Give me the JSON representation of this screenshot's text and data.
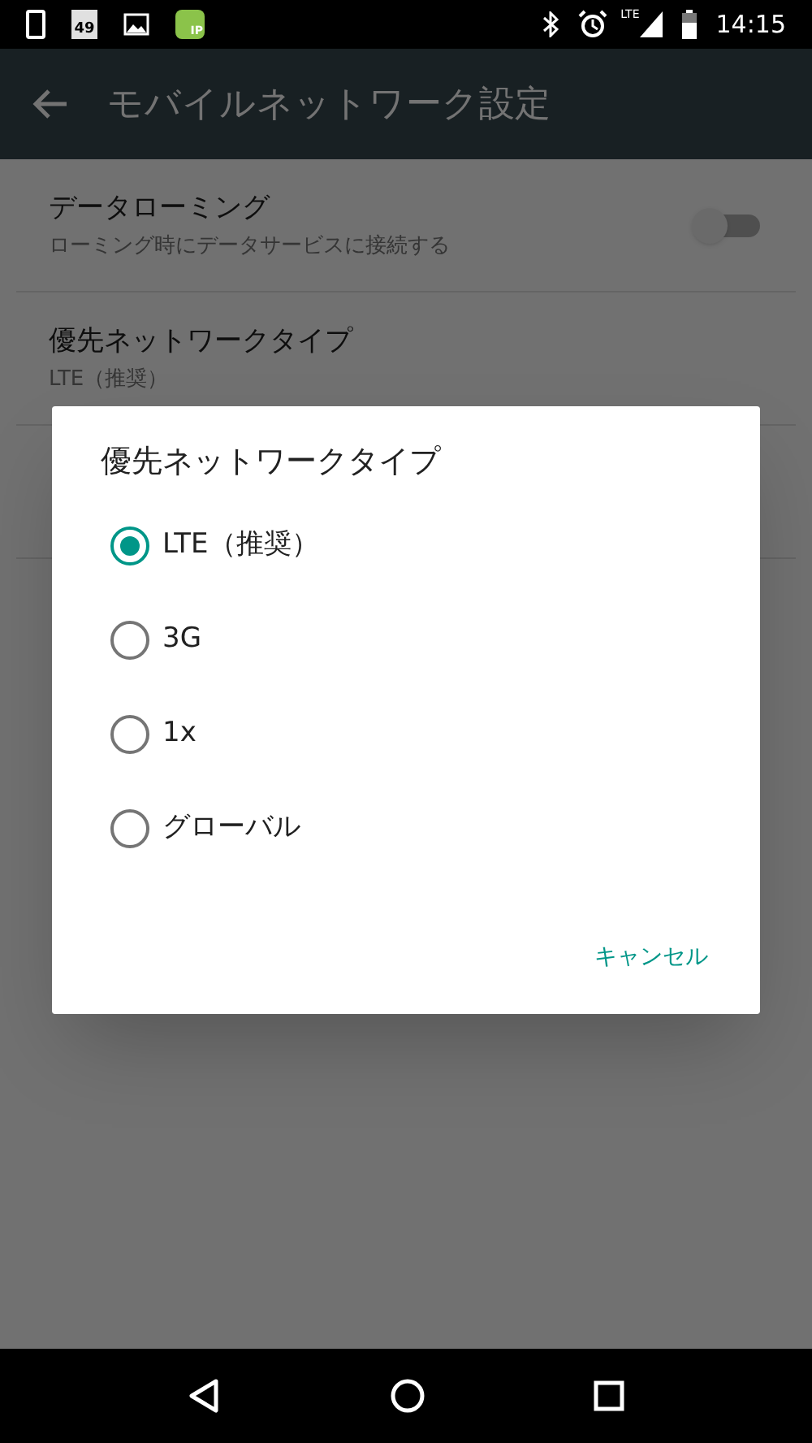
{
  "status_bar": {
    "calendar_day": "49",
    "app_badge": "IP",
    "network": "LTE",
    "time": "14:15"
  },
  "app_bar": {
    "title": "モバイルネットワーク設定"
  },
  "settings": [
    {
      "kind": "switch",
      "title": "データローミング",
      "summary": "ローミング時にデータサービスに接続する",
      "on": false
    },
    {
      "kind": "plain",
      "title": "優先ネットワークタイプ",
      "summary": "LTE（推奨）"
    }
  ],
  "dialog": {
    "title": "優先ネットワークタイプ",
    "options": [
      {
        "label": "LTE（推奨）",
        "selected": true
      },
      {
        "label": "3G",
        "selected": false
      },
      {
        "label": "1x",
        "selected": false
      },
      {
        "label": "グローバル",
        "selected": false
      }
    ],
    "cancel": "キャンセル"
  }
}
